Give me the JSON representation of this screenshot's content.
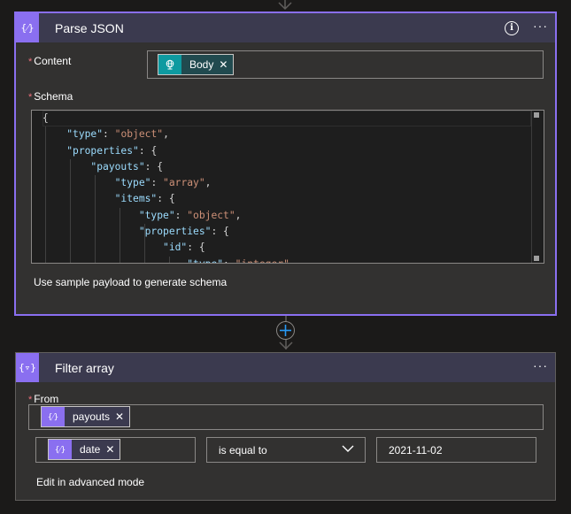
{
  "parse_json": {
    "title": "Parse JSON",
    "icon": "expression-icon",
    "content_label": "Content",
    "content_token": {
      "label": "Body",
      "icon": "http-globe-icon"
    },
    "schema_label": "Schema",
    "schema_lines": [
      [
        {
          "t": "p",
          "v": "{"
        }
      ],
      [
        {
          "t": "p",
          "v": "    "
        },
        {
          "t": "k",
          "v": "\"type\""
        },
        {
          "t": "p",
          "v": ": "
        },
        {
          "t": "s",
          "v": "\"object\""
        },
        {
          "t": "p",
          "v": ","
        }
      ],
      [
        {
          "t": "p",
          "v": "    "
        },
        {
          "t": "k",
          "v": "\"properties\""
        },
        {
          "t": "p",
          "v": ": {"
        }
      ],
      [
        {
          "t": "p",
          "v": "        "
        },
        {
          "t": "k",
          "v": "\"payouts\""
        },
        {
          "t": "p",
          "v": ": {"
        }
      ],
      [
        {
          "t": "p",
          "v": "            "
        },
        {
          "t": "k",
          "v": "\"type\""
        },
        {
          "t": "p",
          "v": ": "
        },
        {
          "t": "s",
          "v": "\"array\""
        },
        {
          "t": "p",
          "v": ","
        }
      ],
      [
        {
          "t": "p",
          "v": "            "
        },
        {
          "t": "k",
          "v": "\"items\""
        },
        {
          "t": "p",
          "v": ": {"
        }
      ],
      [
        {
          "t": "p",
          "v": "                "
        },
        {
          "t": "k",
          "v": "\"type\""
        },
        {
          "t": "p",
          "v": ": "
        },
        {
          "t": "s",
          "v": "\"object\""
        },
        {
          "t": "p",
          "v": ","
        }
      ],
      [
        {
          "t": "p",
          "v": "                "
        },
        {
          "t": "k",
          "v": "\"properties\""
        },
        {
          "t": "p",
          "v": ": {"
        }
      ],
      [
        {
          "t": "p",
          "v": "                    "
        },
        {
          "t": "k",
          "v": "\"id\""
        },
        {
          "t": "p",
          "v": ": {"
        }
      ],
      [
        {
          "t": "p",
          "v": "                        "
        },
        {
          "t": "k",
          "v": "\"type\""
        },
        {
          "t": "p",
          "v": ": "
        },
        {
          "t": "s",
          "v": "\"integer\""
        }
      ]
    ],
    "sample_link": "Use sample payload to generate schema",
    "info_icon": "info-icon",
    "more_icon": "more-icon"
  },
  "connector": {
    "add_icon": "plus-icon"
  },
  "filter_array": {
    "title": "Filter array",
    "icon": "filter-icon",
    "from_label": "From",
    "from_token": {
      "label": "payouts",
      "icon": "expression-icon"
    },
    "condition": {
      "left_token": {
        "label": "date",
        "icon": "expression-icon"
      },
      "operator": "is equal to",
      "right_value": "2021-11-02"
    },
    "advanced_link": "Edit in advanced mode",
    "more_icon": "more-icon"
  },
  "colors": {
    "accent": "#8a6ff0",
    "http_teal": "#0e9aa0",
    "required": "#f1707b",
    "json_key": "#9cdcfe",
    "json_string": "#ce9178"
  }
}
